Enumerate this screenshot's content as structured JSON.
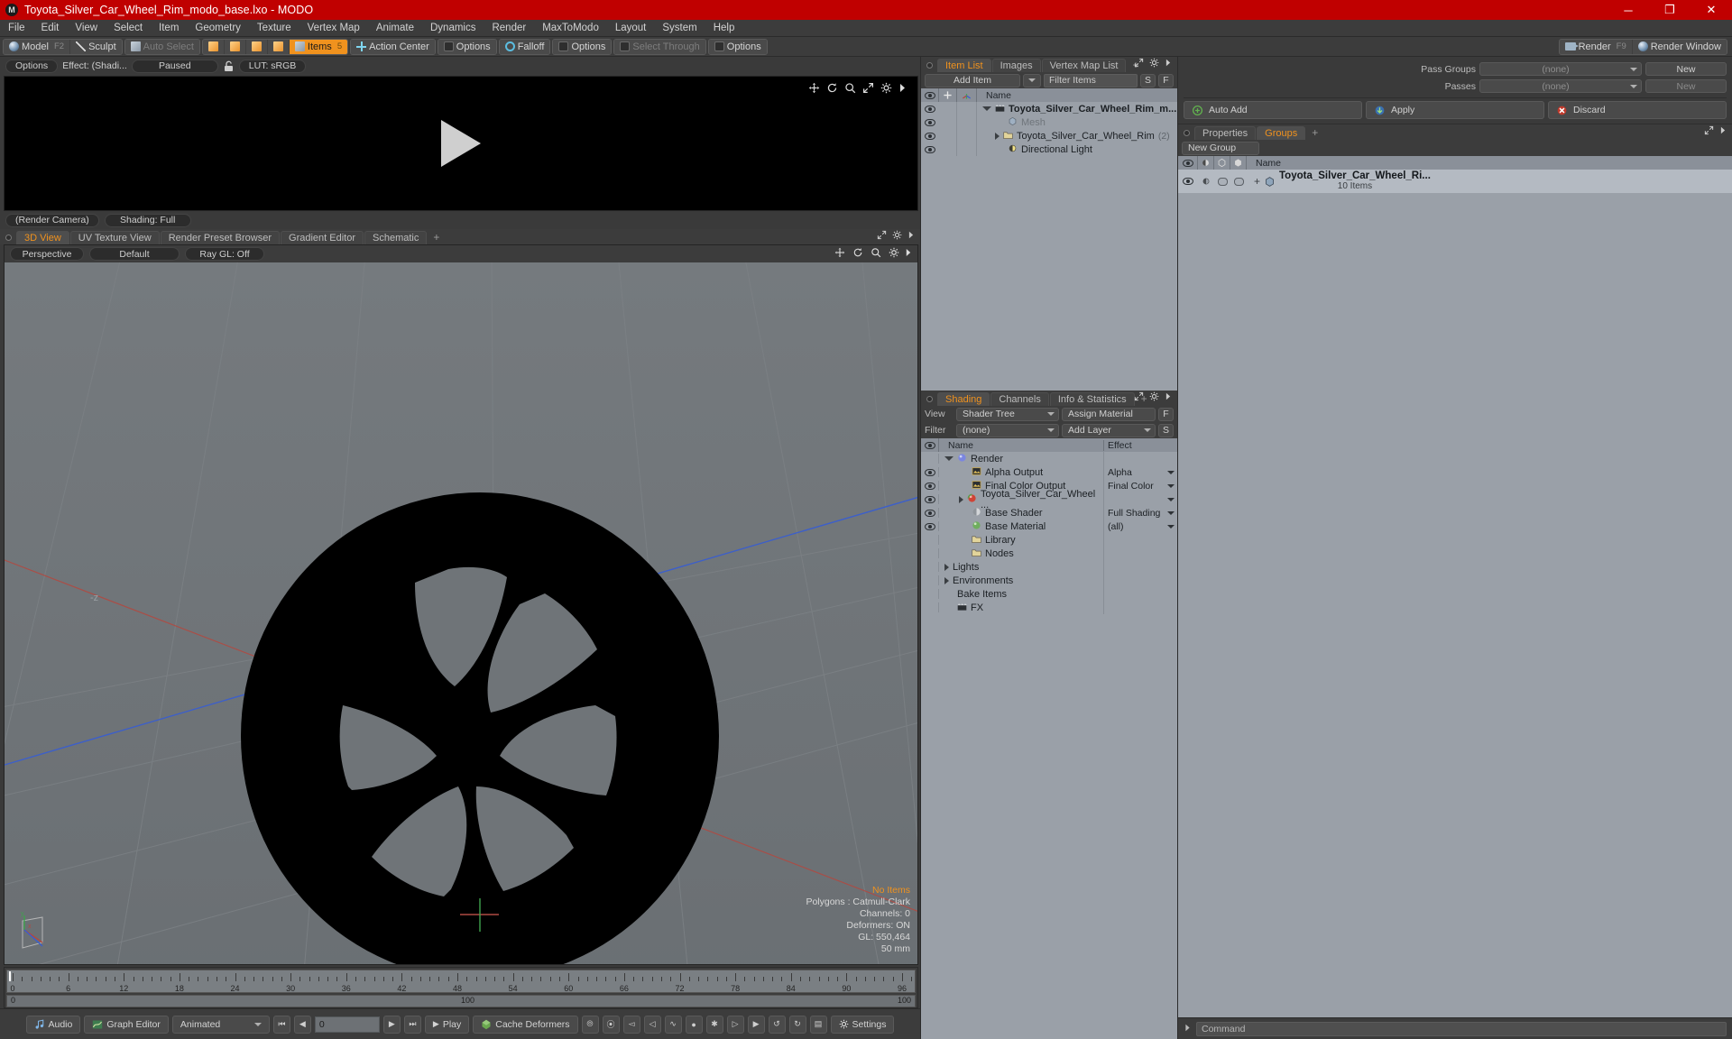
{
  "window": {
    "title": "Toyota_Silver_Car_Wheel_Rim_modo_base.lxo - MODO",
    "minimize": "─",
    "maximize": "❐",
    "close": "✕"
  },
  "menubar": {
    "items": [
      "File",
      "Edit",
      "View",
      "Select",
      "Item",
      "Geometry",
      "Texture",
      "Vertex Map",
      "Animate",
      "Dynamics",
      "Render",
      "MaxToModo",
      "Layout",
      "System",
      "Help"
    ]
  },
  "modebar": {
    "model": "Model",
    "model_key": "F2",
    "sculpt": "Sculpt",
    "auto_select": "Auto Select",
    "items": "Items",
    "items_key": "5",
    "action_center": "Action Center",
    "options1": "Options",
    "falloff": "Falloff",
    "options2": "Options",
    "select_through": "Select Through",
    "options3": "Options",
    "render": "Render",
    "render_key": "F9",
    "render_window": "Render Window"
  },
  "preview": {
    "options": "Options",
    "effect": "Effect: (Shadi...",
    "paused": "Paused",
    "lut": "LUT: sRGB",
    "render_camera": "(Render Camera)",
    "shading": "Shading: Full"
  },
  "viewport_tabs": {
    "tabs": [
      "3D View",
      "UV Texture View",
      "Render Preset Browser",
      "Gradient Editor",
      "Schematic"
    ],
    "active": "3D View",
    "plus": "+"
  },
  "viewport_header": {
    "perspective": "Perspective",
    "default": "Default",
    "raygl": "Ray GL: Off"
  },
  "viewport_stats": {
    "no_items": "No Items",
    "polygons": "Polygons : Catmull-Clark",
    "channels": "Channels: 0",
    "deformers": "Deformers: ON",
    "gl": "GL: 550,464",
    "lens": "50 mm"
  },
  "timeline": {
    "ticks": [
      "0",
      "6",
      "12",
      "18",
      "24",
      "30",
      "36",
      "42",
      "48",
      "54",
      "60",
      "66",
      "72",
      "78",
      "84",
      "90",
      "96"
    ],
    "range_start": "0",
    "range_mid": "100",
    "range_end": "100"
  },
  "bottombar": {
    "audio": "Audio",
    "graph_editor": "Graph Editor",
    "animated": "Animated",
    "frame_value": "0",
    "play": "Play",
    "cache_deformers": "Cache Deformers",
    "settings": "Settings"
  },
  "item_list": {
    "tabs": [
      "Item List",
      "Images",
      "Vertex Map List"
    ],
    "active": "Item List",
    "plus": "+",
    "add_item": "Add Item",
    "filter_placeholder": "Filter Items",
    "btn_s": "S",
    "btn_f": "F",
    "col_name": "Name",
    "rows": [
      {
        "name": "Toyota_Silver_Car_Wheel_Rim_m...",
        "suffix": "",
        "indent": 0,
        "icon": "clapper-icon",
        "bold": true,
        "expand": "down"
      },
      {
        "name": "Mesh",
        "suffix": "",
        "indent": 1,
        "icon": "mesh-icon",
        "bold": false,
        "expand": "none",
        "dim": true
      },
      {
        "name": "Toyota_Silver_Car_Wheel_Rim",
        "suffix": "(2)",
        "indent": 1,
        "icon": "folder-icon",
        "bold": false,
        "expand": "right"
      },
      {
        "name": "Directional Light",
        "suffix": "",
        "indent": 1,
        "icon": "light-icon",
        "bold": false,
        "expand": "none"
      }
    ]
  },
  "shading": {
    "tabs": [
      "Shading",
      "Channels",
      "Info & Statistics"
    ],
    "active": "Shading",
    "plus": "+",
    "view_label": "View",
    "view_value": "Shader Tree",
    "assign_material": "Assign Material",
    "btn_f": "F",
    "filter_label": "Filter",
    "filter_value": "(none)",
    "add_layer": "Add Layer",
    "btn_s": "S",
    "col_name": "Name",
    "col_effect": "Effect",
    "rows": [
      {
        "name": "Render",
        "effect": "",
        "indent": 0,
        "icon": "render-sphere-icon",
        "expand": "down",
        "eye": false
      },
      {
        "name": "Alpha Output",
        "effect": "Alpha",
        "indent": 1,
        "icon": "output-icon",
        "expand": "none",
        "eye": true
      },
      {
        "name": "Final Color Output",
        "effect": "Final Color",
        "indent": 1,
        "icon": "output-icon",
        "expand": "none",
        "eye": true
      },
      {
        "name": "Toyota_Silver_Car_Wheel  ...",
        "effect": "",
        "indent": 1,
        "icon": "material-red-icon",
        "expand": "right",
        "eye": true
      },
      {
        "name": "Base Shader",
        "effect": "Full Shading",
        "indent": 1,
        "icon": "shader-gray-icon",
        "expand": "none",
        "eye": true
      },
      {
        "name": "Base Material",
        "effect": "(all)",
        "indent": 1,
        "icon": "material-green-icon",
        "expand": "none",
        "eye": true
      },
      {
        "name": "Library",
        "effect": "",
        "indent": 1,
        "icon": "folder-icon",
        "expand": "none",
        "eye": false
      },
      {
        "name": "Nodes",
        "effect": "",
        "indent": 1,
        "icon": "folder-icon",
        "expand": "none",
        "eye": false
      },
      {
        "name": "Lights",
        "effect": "",
        "indent": 0,
        "icon": "none",
        "expand": "right",
        "eye": false
      },
      {
        "name": "Environments",
        "effect": "",
        "indent": 0,
        "icon": "none",
        "expand": "right",
        "eye": false
      },
      {
        "name": "Bake Items",
        "effect": "",
        "indent": 0,
        "icon": "none",
        "expand": "none",
        "eye": false
      },
      {
        "name": "FX",
        "effect": "",
        "indent": 0,
        "icon": "clapper-icon",
        "expand": "none",
        "eye": false
      }
    ]
  },
  "passes": {
    "pass_groups_label": "Pass Groups",
    "pass_groups_value": "(none)",
    "pass_groups_new": "New",
    "passes_label": "Passes",
    "passes_value": "(none)",
    "passes_new": "New",
    "auto_add": "Auto Add",
    "apply": "Apply",
    "discard": "Discard"
  },
  "groups": {
    "tabs": [
      "Properties",
      "Groups"
    ],
    "active": "Groups",
    "plus": "+",
    "new_group": "New Group",
    "col_name": "Name",
    "row_name": "Toyota_Silver_Car_Wheel_Ri...",
    "row_sub": "10 Items"
  },
  "command": {
    "placeholder": "Command"
  },
  "colors": {
    "title_bar": "#c00000",
    "accent": "#f0921e",
    "panel_bg": "#3c3c3c",
    "list_bg": "#9aa0a8",
    "viewport_bg": "#6f7478"
  }
}
